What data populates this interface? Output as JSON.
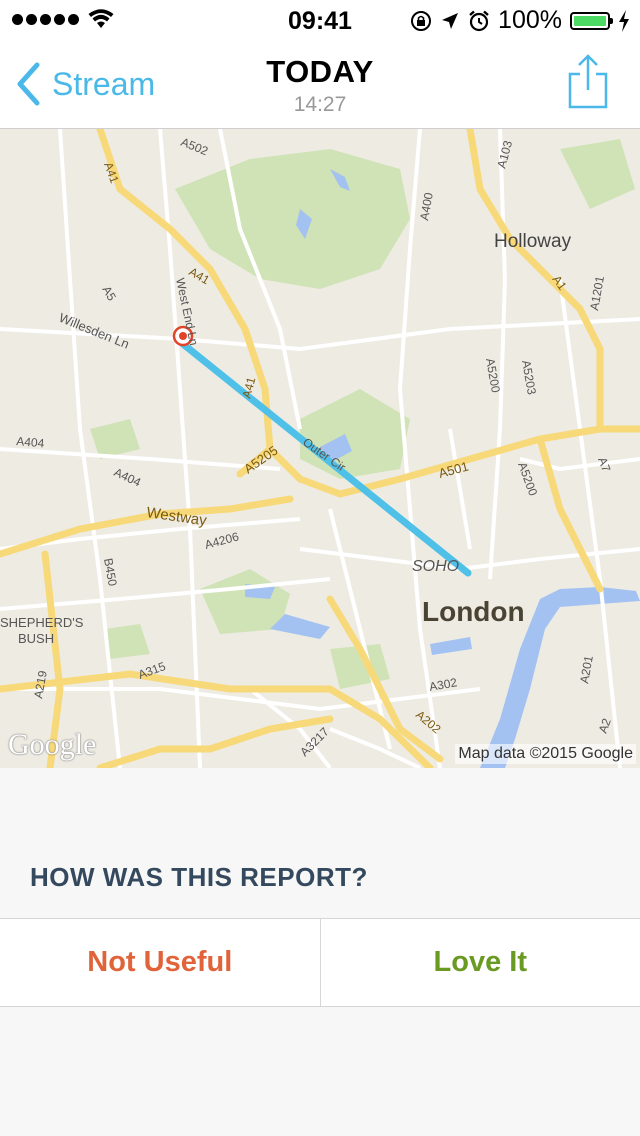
{
  "status_bar": {
    "time": "09:41",
    "battery_percent": "100%",
    "signal_bars": 5,
    "icons": [
      "wifi-icon",
      "rotation-lock-icon",
      "location-arrow-icon",
      "alarm-icon",
      "battery-icon",
      "charging-bolt-icon"
    ]
  },
  "nav": {
    "back_label": "Stream",
    "title": "TODAY",
    "subtitle": "14:27",
    "share_icon": "share-icon"
  },
  "map": {
    "labels": {
      "holloway": "Holloway",
      "london": "London",
      "soho": "SOHO",
      "westway": "Westway",
      "shepherds_bush_1": "SHEPHERD'S",
      "shepherds_bush_2": "BUSH",
      "willesden": "Willesden Ln",
      "west_end_ln": "West End Ln",
      "outer_cir": "Outer Cir",
      "a502": "A502",
      "a41_top": "A41",
      "a41_mid": "A41",
      "a41_low": "A41",
      "a5": "A5",
      "a400": "A400",
      "a103": "A103",
      "a1": "A1",
      "a1201": "A1201",
      "a5200_1": "A5200",
      "a5203": "A5203",
      "a5200_2": "A5200",
      "a404_1": "A404",
      "a404_2": "A404",
      "a5205": "A5205",
      "a501": "A501",
      "a4206": "A4206",
      "b450": "B450",
      "a7": "A7",
      "a315": "A315",
      "a219": "A219",
      "a201": "A201",
      "a302": "A302",
      "a202": "A202",
      "a3217": "A3217",
      "a2": "A2"
    },
    "attribution": "Map data ©2015 Google",
    "logo": "Google",
    "route_color": "#4fc0e8",
    "pin_color": "#e0452a"
  },
  "feedback": {
    "question": "HOW WAS THIS REPORT?",
    "negative_label": "Not Useful",
    "positive_label": "Love It",
    "negative_color": "#e0633a",
    "positive_color": "#6a9a22"
  }
}
